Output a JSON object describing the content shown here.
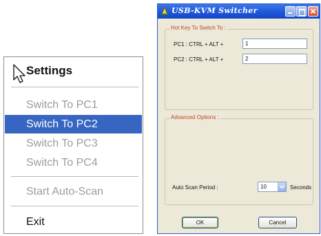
{
  "menu": {
    "title": "Settings",
    "items": [
      {
        "label": "Switch To PC1",
        "state": "disabled"
      },
      {
        "label": "Switch To PC2",
        "state": "selected"
      },
      {
        "label": "Switch To PC3",
        "state": "disabled"
      },
      {
        "label": "Switch To PC4",
        "state": "disabled"
      }
    ],
    "auto_scan_label": "Start Auto-Scan",
    "exit_label": "Exit"
  },
  "window": {
    "title": "USB-KVM Switcher",
    "hotkey_group": {
      "label": "Hot Key To Switch To :",
      "pc1_label": "PC1 : CTRL + ALT +",
      "pc1_value": "1",
      "pc2_label": "PC2 : CTRL + ALT +",
      "pc2_value": "2"
    },
    "advanced_group": {
      "label": "Advanced Options :",
      "scan_period_label": "Auto Scan Period :",
      "scan_period_value": "10",
      "scan_period_unit": "Seconds"
    },
    "ok_label": "OK",
    "cancel_label": "Cancel"
  },
  "colors": {
    "menu_highlight": "#3766c2",
    "titlebar": "#1c55d8",
    "group_label": "#c0442a",
    "dialog_bg": "#ece9d8"
  }
}
